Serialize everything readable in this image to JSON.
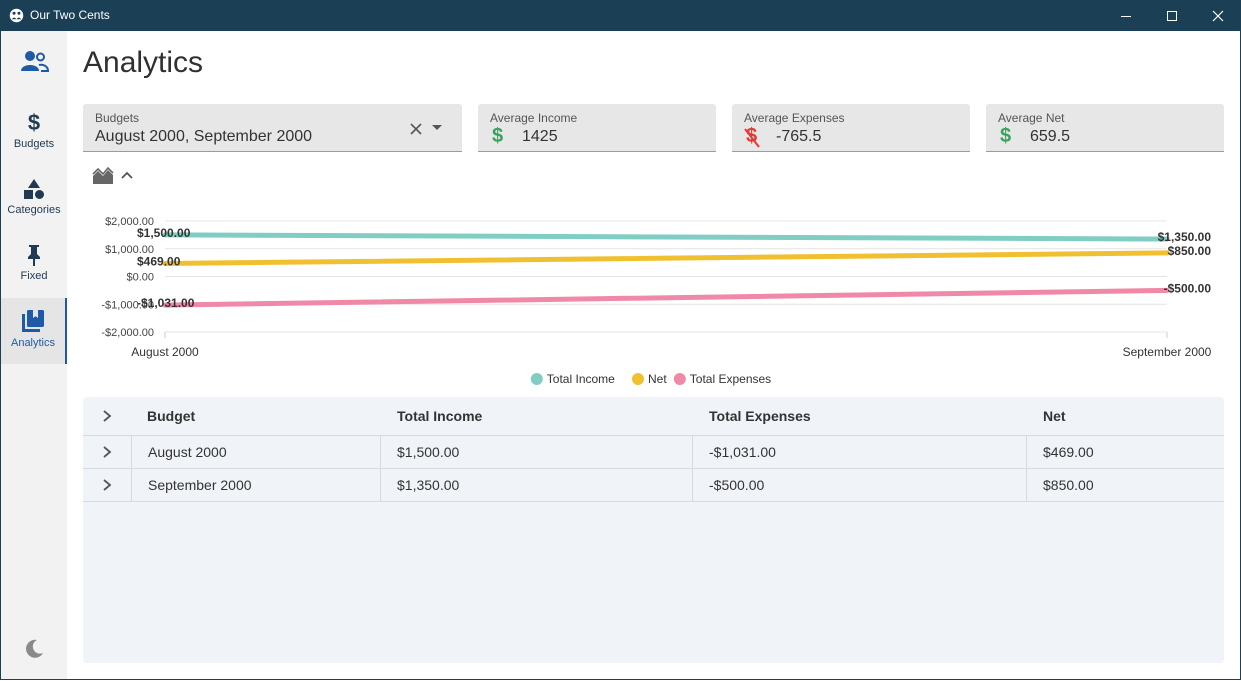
{
  "app": {
    "title": "Our Two Cents"
  },
  "sidebar": {
    "items": [
      {
        "label": ""
      },
      {
        "label": "Budgets"
      },
      {
        "label": "Categories"
      },
      {
        "label": "Fixed"
      },
      {
        "label": "Analytics"
      }
    ]
  },
  "page": {
    "title": "Analytics"
  },
  "filters": {
    "budgets": {
      "label": "Budgets",
      "value": "August 2000, September 2000"
    },
    "avg_income": {
      "label": "Average Income",
      "value": "1425",
      "icon": "dollar-icon",
      "color": "#3aa35b"
    },
    "avg_expenses": {
      "label": "Average Expenses",
      "value": "-765.5",
      "icon": "dollar-off-icon",
      "color": "#e53935"
    },
    "avg_net": {
      "label": "Average Net",
      "value": "659.5",
      "icon": "dollar-icon",
      "color": "#3aa35b"
    }
  },
  "chart_data": {
    "type": "line",
    "x": [
      "August 2000",
      "September 2000"
    ],
    "yticks": [
      "$2,000.00",
      "$1,000.00",
      "$0.00",
      "-$1,000.00",
      "-$2,000.00"
    ],
    "ylim": [
      -2000,
      2000
    ],
    "grid": true,
    "legend_position": "bottom",
    "series": [
      {
        "name": "Total Income",
        "values": [
          1500,
          1350
        ],
        "labels": [
          "$1,500.00",
          "$1,350.00"
        ],
        "color": "#7fcdc3"
      },
      {
        "name": "Net",
        "values": [
          469,
          850
        ],
        "labels": [
          "$469.00",
          "$850.00"
        ],
        "color": "#f0c030"
      },
      {
        "name": "Total Expenses",
        "values": [
          -1031,
          -500
        ],
        "labels": [
          "-$1,031.00",
          "-$500.00"
        ],
        "color": "#f088a8"
      }
    ]
  },
  "table": {
    "headers": [
      "Budget",
      "Total Income",
      "Total Expenses",
      "Net"
    ],
    "rows": [
      [
        "August 2000",
        "$1,500.00",
        "-$1,031.00",
        "$469.00"
      ],
      [
        "September 2000",
        "$1,350.00",
        "-$500.00",
        "$850.00"
      ]
    ]
  }
}
